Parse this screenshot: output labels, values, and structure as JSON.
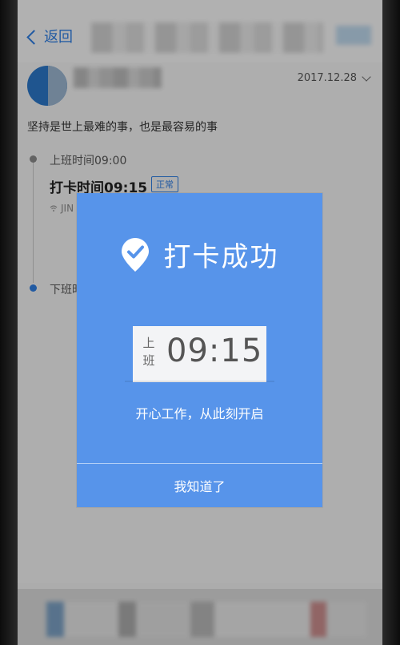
{
  "header": {
    "back_label": "返回"
  },
  "record": {
    "date": "2017.12.28",
    "motto": "坚持是世上最难的事，也是最容易的事",
    "checkin_label": "上班时间09:00",
    "punch_time": "打卡时间09:15",
    "status_badge": "正常",
    "wifi_text": "JIN",
    "checkout_label": "下班时"
  },
  "modal": {
    "title": "打卡成功",
    "ticket_side_1": "上",
    "ticket_side_2": "班",
    "time": "09:15",
    "subtitle": "开心工作，从此刻开启",
    "confirm_label": "我知道了"
  },
  "colors": {
    "modal_bg": "#5794ea",
    "accent": "#2f7de1"
  }
}
